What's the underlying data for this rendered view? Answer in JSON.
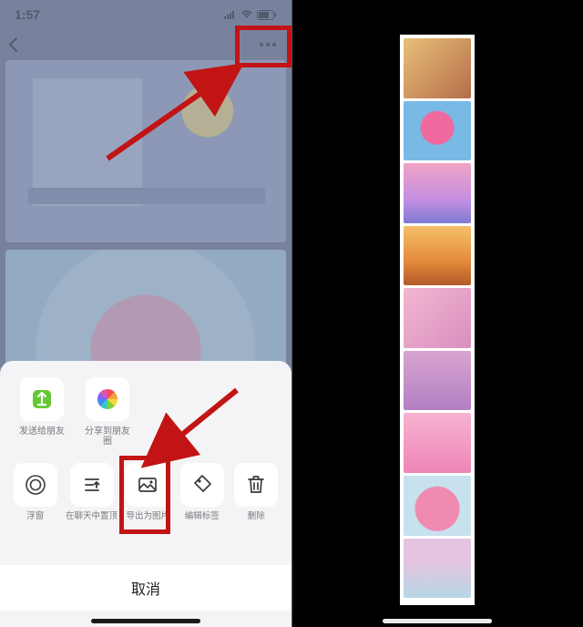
{
  "status": {
    "time": "1:57",
    "signal_icon": "signal-icon",
    "wifi_icon": "wifi-icon",
    "battery_icon": "battery-icon"
  },
  "nav": {
    "back_icon": "chevron-left-icon",
    "more_icon": "more-dots-icon"
  },
  "share_row": [
    {
      "icon": "wechat-send-icon",
      "label": "发送给朋友"
    },
    {
      "icon": "moments-icon",
      "label": "分享到朋友圈"
    }
  ],
  "action_row": [
    {
      "icon": "float-window-icon",
      "label": "浮窗"
    },
    {
      "icon": "pin-chat-icon",
      "label": "在聊天中置顶"
    },
    {
      "icon": "export-image-icon",
      "label": "导出为图片"
    },
    {
      "icon": "tag-icon",
      "label": "编辑标签"
    },
    {
      "icon": "trash-icon",
      "label": "删除"
    }
  ],
  "sheet": {
    "cancel": "取消"
  },
  "annotations": {
    "highlight_more": "highlight-more-menu",
    "highlight_export": "highlight-export-as-image",
    "arrow1": "arrow-to-more",
    "arrow2": "arrow-to-export"
  },
  "preview_strip": {
    "count": 9
  },
  "colors": {
    "annotation_red": "#c21414",
    "sheet_bg": "#f4f4f6",
    "dim_bg": "#6d7792"
  }
}
